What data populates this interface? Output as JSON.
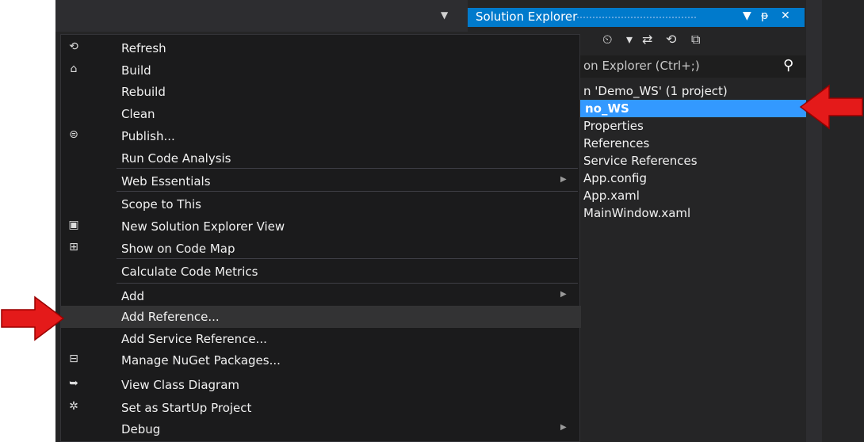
{
  "solution_explorer": {
    "title": "Solution Explorer",
    "search_placeholder": "on Explorer (Ctrl+;)",
    "tree": [
      {
        "label": "n 'Demo_WS' (1 project)",
        "selected": false
      },
      {
        "label": "no_WS",
        "selected": true
      },
      {
        "label": "Properties",
        "selected": false
      },
      {
        "label": "References",
        "selected": false
      },
      {
        "label": "Service References",
        "selected": false
      },
      {
        "label": "App.config",
        "selected": false
      },
      {
        "label": "App.xaml",
        "selected": false
      },
      {
        "label": "MainWindow.xaml",
        "selected": false
      }
    ]
  },
  "context_menu": {
    "items": [
      {
        "label": "Refresh",
        "icon": "refresh-icon"
      },
      {
        "label": "Build",
        "icon": "build-icon"
      },
      {
        "label": "Rebuild"
      },
      {
        "label": "Clean"
      },
      {
        "label": "Publish...",
        "icon": "publish-icon"
      },
      {
        "label": "Run Code Analysis"
      },
      {
        "label": "Web Essentials",
        "submenu": true
      },
      {
        "label": "Scope to This"
      },
      {
        "label": "New Solution Explorer View",
        "icon": "new-view-icon"
      },
      {
        "label": "Show on Code Map",
        "icon": "code-map-icon"
      },
      {
        "label": "Calculate Code Metrics"
      },
      {
        "label": "Add",
        "submenu": true
      },
      {
        "label": "Add Reference...",
        "highlighted": true
      },
      {
        "label": "Add Service Reference..."
      },
      {
        "label": "Manage NuGet Packages...",
        "icon": "nuget-icon"
      },
      {
        "label": "View Class Diagram",
        "icon": "class-diagram-icon"
      },
      {
        "label": "Set as StartUp Project",
        "icon": "gear-icon"
      },
      {
        "label": "Debug",
        "submenu": true
      }
    ]
  },
  "colors": {
    "accent": "#007acc",
    "selection": "#3399ff",
    "menu_bg": "#1b1b1c",
    "annotation_arrow": "#e41a1a"
  }
}
